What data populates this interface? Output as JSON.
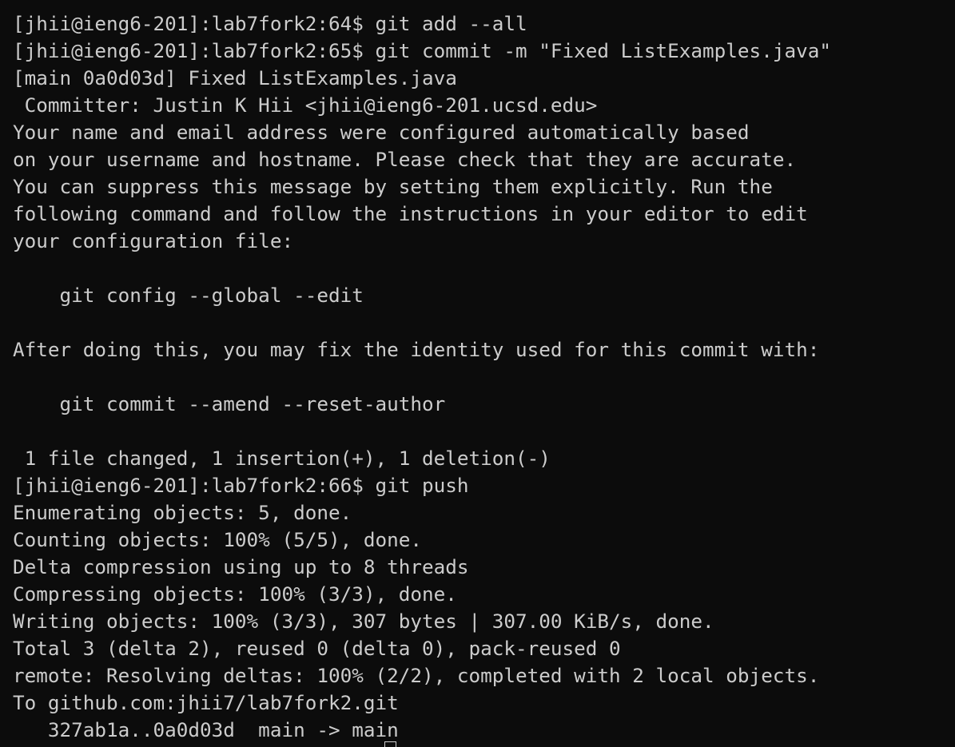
{
  "terminal": {
    "lines": [
      "[jhii@ieng6-201]:lab7fork2:64$ git add --all",
      "[jhii@ieng6-201]:lab7fork2:65$ git commit -m \"Fixed ListExamples.java\"",
      "[main 0a0d03d] Fixed ListExamples.java",
      " Committer: Justin K Hii <jhii@ieng6-201.ucsd.edu>",
      "Your name and email address were configured automatically based",
      "on your username and hostname. Please check that they are accurate.",
      "You can suppress this message by setting them explicitly. Run the",
      "following command and follow the instructions in your editor to edit",
      "your configuration file:",
      "",
      "    git config --global --edit",
      "",
      "After doing this, you may fix the identity used for this commit with:",
      "",
      "    git commit --amend --reset-author",
      "",
      " 1 file changed, 1 insertion(+), 1 deletion(-)",
      "[jhii@ieng6-201]:lab7fork2:66$ git push",
      "Enumerating objects: 5, done.",
      "Counting objects: 100% (5/5), done.",
      "Delta compression using up to 8 threads",
      "Compressing objects: 100% (3/3), done.",
      "Writing objects: 100% (3/3), 307 bytes | 307.00 KiB/s, done.",
      "Total 3 (delta 2), reused 0 (delta 0), pack-reused 0",
      "remote: Resolving deltas: 100% (2/2), completed with 2 local objects.",
      "To github.com:jhii7/lab7fork2.git",
      "   327ab1a..0a0d03d  main -> main"
    ]
  },
  "colors": {
    "background": "#0c0c0c",
    "foreground": "#cccccc"
  }
}
